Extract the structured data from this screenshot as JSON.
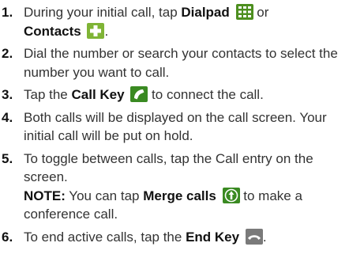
{
  "steps": [
    {
      "number": "1.",
      "t1": "During your initial call, tap ",
      "b1": "Dialpad",
      "t2": " or",
      "b2": "Contacts",
      "t3": "."
    },
    {
      "number": "2.",
      "text": "Dial the number or search your contacts to select the number you want to call."
    },
    {
      "number": "3.",
      "t1": "Tap the ",
      "b1": "Call Key",
      "t2": " to connect the call."
    },
    {
      "number": "4.",
      "text": "Both calls will be displayed on the call screen. Your initial call will be put on hold."
    },
    {
      "number": "5.",
      "text": "To toggle between calls, tap the Call entry on the screen.",
      "note_label": "NOTE:",
      "note_t1": " You can tap ",
      "note_b1": "Merge calls",
      "note_t2": " to make a conference call."
    },
    {
      "number": "6.",
      "t1": "To end active calls, tap the ",
      "b1": "End Key",
      "t2": "."
    }
  ],
  "icons": {
    "dialpad": "dialpad-icon",
    "contacts": "contacts-icon",
    "call_key": "call-key-icon",
    "merge_calls": "merge-calls-icon",
    "end_key": "end-key-icon"
  },
  "colors": {
    "dialpad": "#4d8f1f",
    "contacts": "#7fb436",
    "call_key": "#3a8a22",
    "merge_calls": "#3a8a22",
    "end_key": "#7a7a7a"
  }
}
